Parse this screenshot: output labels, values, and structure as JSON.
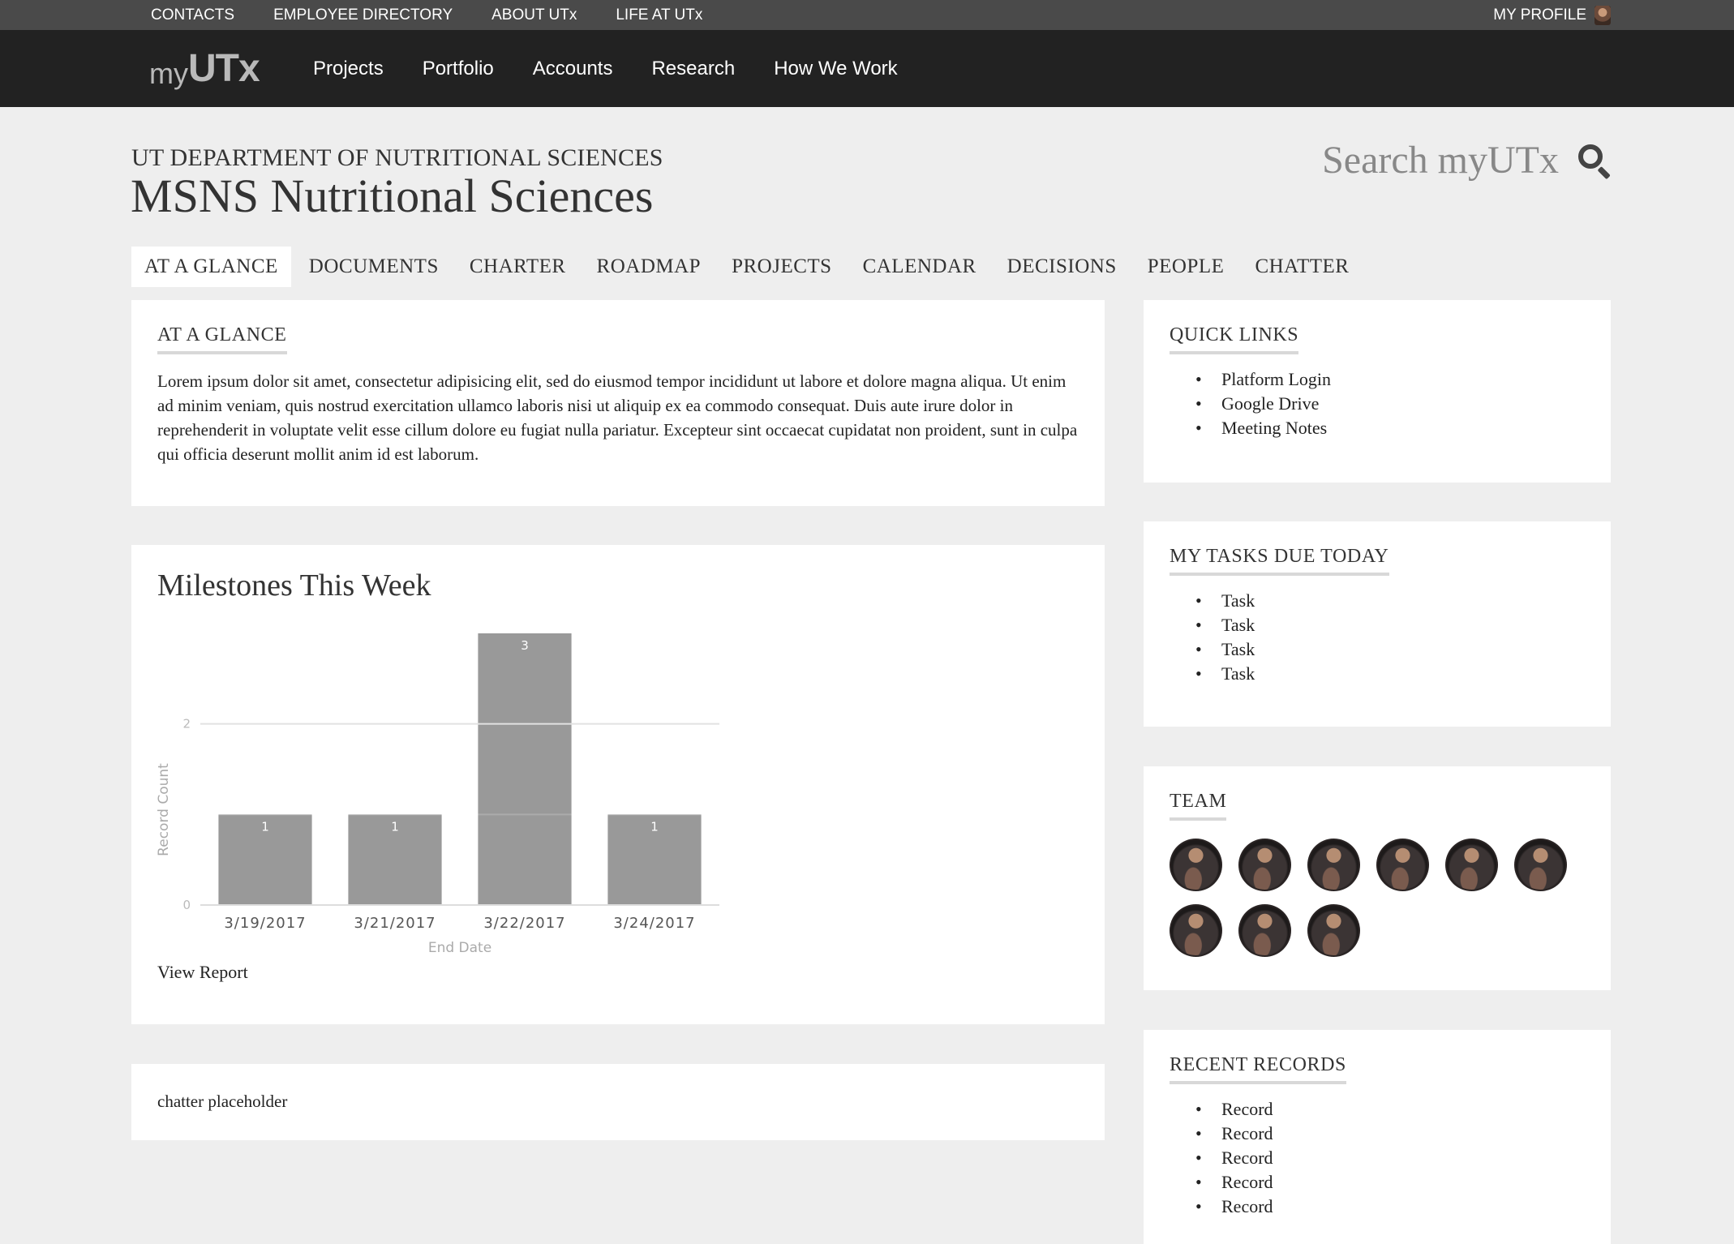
{
  "utility_bar": {
    "links": [
      "CONTACTS",
      "EMPLOYEE DIRECTORY",
      "ABOUT UTx",
      "LIFE AT UTx"
    ],
    "profile_label": "MY PROFILE"
  },
  "brand": {
    "logo_my": "my",
    "logo_utx": "UTx"
  },
  "main_nav": [
    "Projects",
    "Portfolio",
    "Accounts",
    "Research",
    "How We Work"
  ],
  "header": {
    "department": "UT DEPARTMENT OF NUTRITIONAL SCIENCES",
    "title": "MSNS Nutritional Sciences",
    "search_label": "Search myUTx"
  },
  "tabs": [
    {
      "label": "AT A GLANCE",
      "active": true
    },
    {
      "label": "DOCUMENTS",
      "active": false
    },
    {
      "label": "CHARTER",
      "active": false
    },
    {
      "label": "ROADMAP",
      "active": false
    },
    {
      "label": "PROJECTS",
      "active": false
    },
    {
      "label": "CALENDAR",
      "active": false
    },
    {
      "label": "DECISIONS",
      "active": false
    },
    {
      "label": "PEOPLE",
      "active": false
    },
    {
      "label": "CHATTER",
      "active": false
    }
  ],
  "glance": {
    "heading": "AT A GLANCE",
    "text": "Lorem ipsum dolor sit amet, consectetur adipisicing elit, sed do eiusmod tempor incididunt ut labore et dolore magna aliqua. Ut enim ad minim veniam, quis nostrud exercitation ullamco laboris nisi ut aliquip ex ea commodo consequat. Duis aute irure dolor in reprehenderit in voluptate velit esse cillum dolore eu fugiat nulla pariatur. Excepteur sint occaecat cupidatat non proident, sunt in culpa qui officia deserunt mollit anim id est laborum."
  },
  "milestones": {
    "title": "Milestones This Week",
    "view_report": "View Report"
  },
  "chart_data": {
    "type": "bar",
    "categories": [
      "3/19/2017",
      "3/21/2017",
      "3/22/2017",
      "3/24/2017"
    ],
    "values": [
      1,
      1,
      3,
      1
    ],
    "xlabel": "End Date",
    "ylabel": "Record Count",
    "ylim": [
      0,
      3
    ],
    "yticks": [
      0,
      2
    ],
    "grid": true,
    "bar_color": "#999999"
  },
  "chatter": {
    "text": "chatter placeholder"
  },
  "quick_links": {
    "heading": "QUICK LINKS",
    "items": [
      "Platform Login",
      "Google Drive",
      "Meeting Notes"
    ]
  },
  "tasks": {
    "heading": "MY TASKS DUE TODAY",
    "items": [
      "Task",
      "Task",
      "Task",
      "Task"
    ]
  },
  "team": {
    "heading": "TEAM",
    "member_count": 9
  },
  "recent_records": {
    "heading": "RECENT RECORDS",
    "items": [
      "Record",
      "Record",
      "Record",
      "Record",
      "Record"
    ]
  },
  "colors": {
    "utility_bar": "#4a4a4a",
    "main_nav": "#222222",
    "page_bg": "#eeeeee",
    "card_bg": "#ffffff"
  }
}
